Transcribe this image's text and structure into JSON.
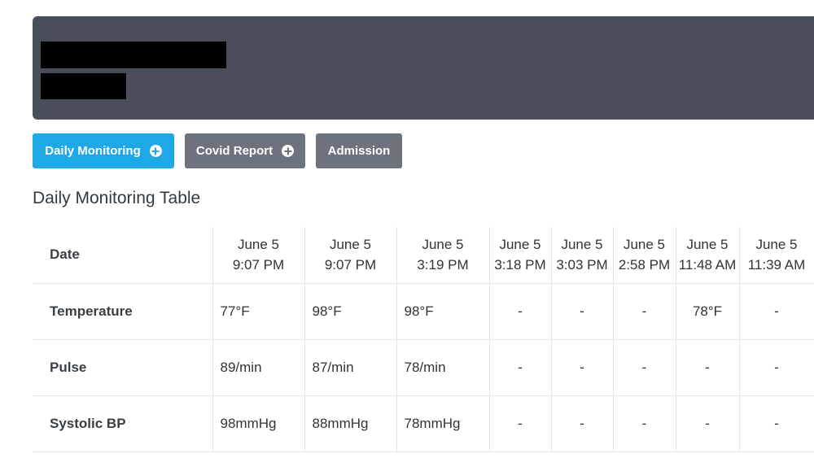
{
  "buttons": {
    "daily_monitoring": "Daily Monitoring",
    "covid_report": "Covid Report",
    "admission": "Admission"
  },
  "section_title": "Daily Monitoring Table",
  "table": {
    "row_header_label": "Date",
    "columns": [
      {
        "date": "June 5",
        "time": "9:07 PM"
      },
      {
        "date": "June 5",
        "time": "9:07 PM"
      },
      {
        "date": "June 5",
        "time": "3:19 PM"
      },
      {
        "date": "June 5",
        "time": "3:18 PM"
      },
      {
        "date": "June 5",
        "time": "3:03 PM"
      },
      {
        "date": "June 5",
        "time": "2:58 PM"
      },
      {
        "date": "June 5",
        "time": "11:48 AM"
      },
      {
        "date": "June 5",
        "time": "11:39 AM"
      }
    ],
    "rows": [
      {
        "label": "Temperature",
        "values": [
          "77°F",
          "98°F",
          "98°F",
          "-",
          "-",
          "-",
          "78°F",
          "-"
        ]
      },
      {
        "label": "Pulse",
        "values": [
          "89/min",
          "87/min",
          "78/min",
          "-",
          "-",
          "-",
          "-",
          "-"
        ]
      },
      {
        "label": "Systolic BP",
        "values": [
          "98mmHg",
          "88mmHg",
          "78mmHg",
          "-",
          "-",
          "-",
          "-",
          "-"
        ]
      }
    ]
  }
}
